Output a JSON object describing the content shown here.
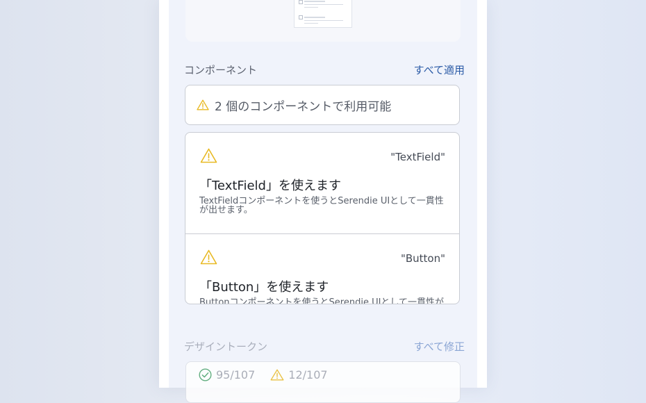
{
  "components": {
    "title": "コンポーネント",
    "action": "すべて適用",
    "summary": "2 個のコンポーネントで利用可能",
    "cards": [
      {
        "tag": "\"TextField\"",
        "title": "「TextField」を使えます",
        "desc": "TextFieldコンポーネントを使うとSerendie UIとして一貫性が出せます。"
      },
      {
        "tag": "\"Button\"",
        "title": "「Button」を使えます",
        "desc": "Buttonコンポーネントを使うとSerendie UIとして一貫性が出せます。"
      }
    ]
  },
  "design_tokens": {
    "title": "デザイントークン",
    "action": "すべて修正",
    "ok_count": "95/107",
    "warn_count": "12/107"
  },
  "colors": {
    "accent": "#2a5aa6",
    "warning": "#e8b923",
    "success": "#4aa36b"
  },
  "icons": [
    "warning-icon",
    "check-circle-icon"
  ]
}
